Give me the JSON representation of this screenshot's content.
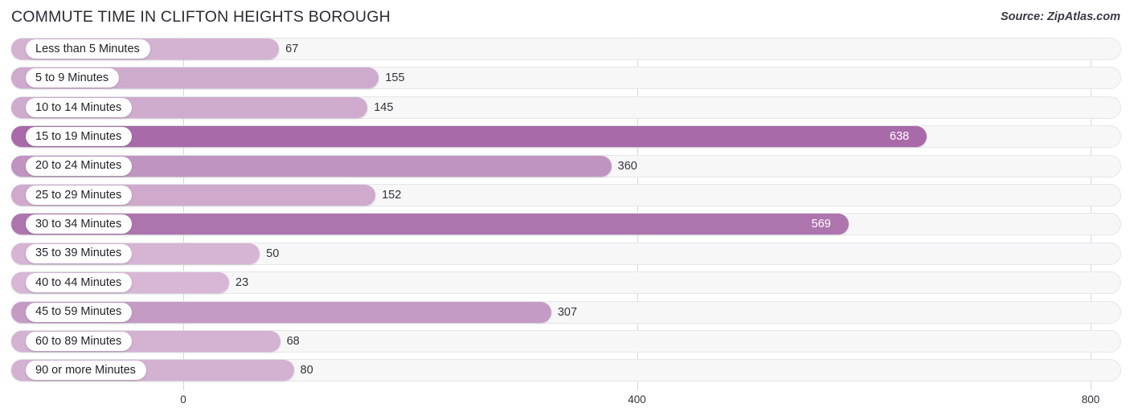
{
  "header": {
    "title": "COMMUTE TIME IN CLIFTON HEIGHTS BOROUGH",
    "source": "Source: ZipAtlas.com"
  },
  "colors": {
    "bar_light": "#d9b9d6",
    "bar_mid": "#c39ac4",
    "bar_dark": "#a86aa8",
    "track": "#f7f7f8",
    "gridline": "#d8d8dc",
    "label_text": "#23232b",
    "value_text": "#33333c",
    "value_text_inside": "#ffffff"
  },
  "chart_data": {
    "type": "bar",
    "orientation": "horizontal",
    "title": "COMMUTE TIME IN CLIFTON HEIGHTS BOROUGH",
    "xlabel": "",
    "ylabel": "",
    "xlim": [
      0,
      800
    ],
    "xticks": [
      0,
      400,
      800
    ],
    "xtick_labels": [
      "0",
      "400",
      "800"
    ],
    "grid": true,
    "legend": false,
    "categories": [
      "Less than 5 Minutes",
      "5 to 9 Minutes",
      "10 to 14 Minutes",
      "15 to 19 Minutes",
      "20 to 24 Minutes",
      "25 to 29 Minutes",
      "30 to 34 Minutes",
      "35 to 39 Minutes",
      "40 to 44 Minutes",
      "45 to 59 Minutes",
      "60 to 89 Minutes",
      "90 or more Minutes"
    ],
    "values": [
      67,
      155,
      145,
      638,
      360,
      152,
      569,
      50,
      23,
      307,
      68,
      80
    ],
    "value_labels": [
      "67",
      "155",
      "145",
      "638",
      "360",
      "152",
      "569",
      "50",
      "23",
      "307",
      "68",
      "80"
    ]
  }
}
